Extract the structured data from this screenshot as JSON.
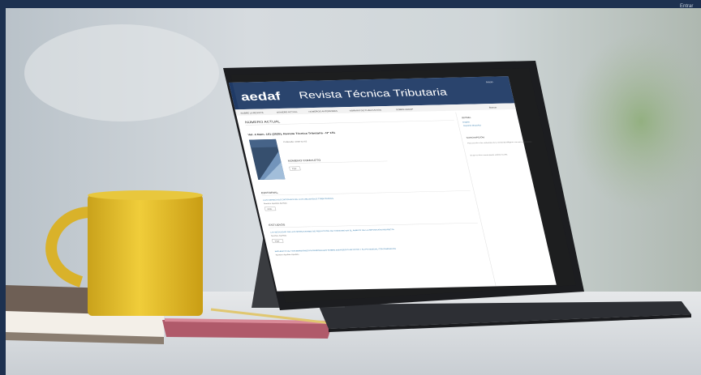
{
  "top_bar": {
    "right_label": "Entrar"
  },
  "site": {
    "logo_text": "aedaf",
    "title": "Revista Técnica Tributaria",
    "header_link": "Inicio",
    "nav": [
      "SOBRE LA REVISTA",
      "NÚMERO ACTUAL",
      "NÚMEROS ANTERIORES",
      "NORMAS DE PUBLICACIÓN",
      "SOBRE AEDAF"
    ],
    "search_label": "Buscar"
  },
  "main": {
    "section_heading": "NÚMERO ACTUAL",
    "issue_title": "Vol. 4 Núm. 151 (2025): Revista Técnica Tributaria - Nº 151",
    "published_label": "Publicado: 2025-12-15",
    "full_issue_heading": "NÚMERO COMPLETO",
    "pdf_label": "PDF",
    "editorial_heading": "EDITORIAL",
    "editorial_article": "LOS DERECHOS DIGITALES DE LOS OBLIGADOS TRIBUTARIOS",
    "editorial_author": "Nombre Apellido Apellido",
    "studies_heading": "ESTUDIOS",
    "study1_title": "LA FISCALIDAD DE LAS OPERACIONES DE REDUCCIÓN DE CONSUMO EN EL ÁMBITO DE LA IMPOSICIÓN INDIRECTA",
    "study1_author": "Nombre Apellido",
    "study2_title": "IMPUESTO DE TRANSMISIONES PATRIMONIALES SOBRE ENVASES PLÁSTICOS Y SU POTENCIAL CONTAMINANTE",
    "study2_author": "Nombre Apellido Apellido"
  },
  "sidebar": {
    "heading1": "IDIOMA",
    "links": [
      "English",
      "Español (España)"
    ],
    "heading2": "SUSCRIPCIÓN",
    "text1": "Para acceder a los contenidos de la revista identifíquese con sus credenciales.",
    "text2": "Si aún no tiene cuenta puede solicitar su alta."
  },
  "colors": {
    "brand": "#1f3a66",
    "background": "#1d3150"
  }
}
